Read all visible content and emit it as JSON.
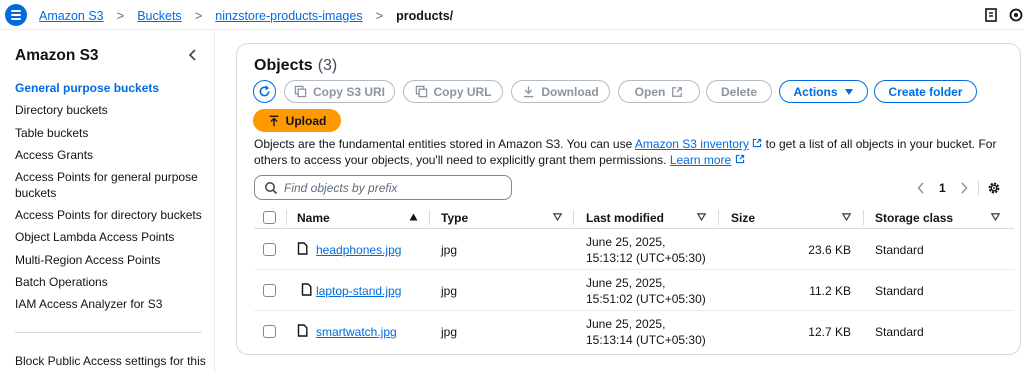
{
  "header": {
    "breadcrumbs": [
      "Amazon S3",
      "Buckets",
      "ninzstore-products-images",
      "products/"
    ]
  },
  "sidebar": {
    "title": "Amazon S3",
    "items": [
      {
        "label": "General purpose buckets",
        "active": true
      },
      {
        "label": "Directory buckets"
      },
      {
        "label": "Table buckets"
      },
      {
        "label": "Access Grants"
      },
      {
        "label": "Access Points for general purpose buckets"
      },
      {
        "label": "Access Points for directory buckets"
      },
      {
        "label": "Object Lambda Access Points"
      },
      {
        "label": "Multi-Region Access Points"
      },
      {
        "label": "Batch Operations"
      },
      {
        "label": "IAM Access Analyzer for S3"
      }
    ],
    "bottom_item": "Block Public Access settings for this"
  },
  "objects": {
    "title": "Objects",
    "count": "(3)",
    "toolbar": {
      "copy_s3_uri": "Copy S3 URI",
      "copy_url": "Copy URL",
      "download": "Download",
      "open": "Open",
      "delete": "Delete",
      "actions": "Actions",
      "create_folder": "Create folder",
      "upload": "Upload"
    },
    "description": {
      "part1": "Objects are the fundamental entities stored in Amazon S3. You can use ",
      "link1": "Amazon S3 inventory",
      "part2": " to get a list of all objects in your bucket. For others to access your objects, you'll need to explicitly grant them permissions. ",
      "link2": "Learn more"
    },
    "search_placeholder": "Find objects by prefix",
    "page": "1",
    "columns": {
      "name": "Name",
      "type": "Type",
      "last_modified": "Last modified",
      "size": "Size",
      "storage_class": "Storage class"
    },
    "rows": [
      {
        "name": "headphones.jpg",
        "type": "jpg",
        "modified_line1": "June 25, 2025,",
        "modified_line2": "15:13:12 (UTC+05:30)",
        "size": "23.6 KB",
        "storage": "Standard"
      },
      {
        "name": "laptop-stand.jpg",
        "type": "jpg",
        "modified_line1": "June 25, 2025,",
        "modified_line2": "15:51:02 (UTC+05:30)",
        "size": "11.2 KB",
        "storage": "Standard"
      },
      {
        "name": "smartwatch.jpg",
        "type": "jpg",
        "modified_line1": "June 25, 2025,",
        "modified_line2": "15:13:14 (UTC+05:30)",
        "size": "12.7 KB",
        "storage": "Standard"
      }
    ]
  },
  "colors": {
    "link": "#006ce0",
    "upload": "#ff9900",
    "border": "#d5dbdb"
  },
  "icons": [
    "menu-icon",
    "chevron-right-icon",
    "feedback-icon",
    "settings-icon",
    "chevron-left-icon",
    "refresh-icon",
    "copy-icon",
    "download-icon",
    "external-link-icon",
    "caret-down-icon",
    "upload-arrow-icon",
    "search-icon",
    "sort-up-icon",
    "sort-down-icon",
    "file-icon",
    "gear-icon"
  ]
}
